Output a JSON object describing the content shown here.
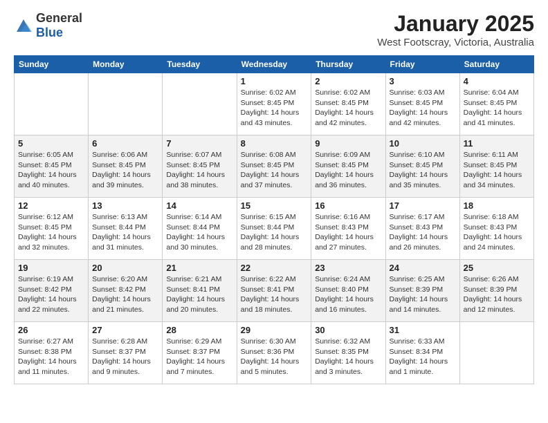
{
  "logo": {
    "general": "General",
    "blue": "Blue"
  },
  "title": "January 2025",
  "subtitle": "West Footscray, Victoria, Australia",
  "headers": [
    "Sunday",
    "Monday",
    "Tuesday",
    "Wednesday",
    "Thursday",
    "Friday",
    "Saturday"
  ],
  "weeks": [
    [
      {
        "day": "",
        "info": ""
      },
      {
        "day": "",
        "info": ""
      },
      {
        "day": "",
        "info": ""
      },
      {
        "day": "1",
        "info": "Sunrise: 6:02 AM\nSunset: 8:45 PM\nDaylight: 14 hours\nand 43 minutes."
      },
      {
        "day": "2",
        "info": "Sunrise: 6:02 AM\nSunset: 8:45 PM\nDaylight: 14 hours\nand 42 minutes."
      },
      {
        "day": "3",
        "info": "Sunrise: 6:03 AM\nSunset: 8:45 PM\nDaylight: 14 hours\nand 42 minutes."
      },
      {
        "day": "4",
        "info": "Sunrise: 6:04 AM\nSunset: 8:45 PM\nDaylight: 14 hours\nand 41 minutes."
      }
    ],
    [
      {
        "day": "5",
        "info": "Sunrise: 6:05 AM\nSunset: 8:45 PM\nDaylight: 14 hours\nand 40 minutes."
      },
      {
        "day": "6",
        "info": "Sunrise: 6:06 AM\nSunset: 8:45 PM\nDaylight: 14 hours\nand 39 minutes."
      },
      {
        "day": "7",
        "info": "Sunrise: 6:07 AM\nSunset: 8:45 PM\nDaylight: 14 hours\nand 38 minutes."
      },
      {
        "day": "8",
        "info": "Sunrise: 6:08 AM\nSunset: 8:45 PM\nDaylight: 14 hours\nand 37 minutes."
      },
      {
        "day": "9",
        "info": "Sunrise: 6:09 AM\nSunset: 8:45 PM\nDaylight: 14 hours\nand 36 minutes."
      },
      {
        "day": "10",
        "info": "Sunrise: 6:10 AM\nSunset: 8:45 PM\nDaylight: 14 hours\nand 35 minutes."
      },
      {
        "day": "11",
        "info": "Sunrise: 6:11 AM\nSunset: 8:45 PM\nDaylight: 14 hours\nand 34 minutes."
      }
    ],
    [
      {
        "day": "12",
        "info": "Sunrise: 6:12 AM\nSunset: 8:45 PM\nDaylight: 14 hours\nand 32 minutes."
      },
      {
        "day": "13",
        "info": "Sunrise: 6:13 AM\nSunset: 8:44 PM\nDaylight: 14 hours\nand 31 minutes."
      },
      {
        "day": "14",
        "info": "Sunrise: 6:14 AM\nSunset: 8:44 PM\nDaylight: 14 hours\nand 30 minutes."
      },
      {
        "day": "15",
        "info": "Sunrise: 6:15 AM\nSunset: 8:44 PM\nDaylight: 14 hours\nand 28 minutes."
      },
      {
        "day": "16",
        "info": "Sunrise: 6:16 AM\nSunset: 8:43 PM\nDaylight: 14 hours\nand 27 minutes."
      },
      {
        "day": "17",
        "info": "Sunrise: 6:17 AM\nSunset: 8:43 PM\nDaylight: 14 hours\nand 26 minutes."
      },
      {
        "day": "18",
        "info": "Sunrise: 6:18 AM\nSunset: 8:43 PM\nDaylight: 14 hours\nand 24 minutes."
      }
    ],
    [
      {
        "day": "19",
        "info": "Sunrise: 6:19 AM\nSunset: 8:42 PM\nDaylight: 14 hours\nand 22 minutes."
      },
      {
        "day": "20",
        "info": "Sunrise: 6:20 AM\nSunset: 8:42 PM\nDaylight: 14 hours\nand 21 minutes."
      },
      {
        "day": "21",
        "info": "Sunrise: 6:21 AM\nSunset: 8:41 PM\nDaylight: 14 hours\nand 20 minutes."
      },
      {
        "day": "22",
        "info": "Sunrise: 6:22 AM\nSunset: 8:41 PM\nDaylight: 14 hours\nand 18 minutes."
      },
      {
        "day": "23",
        "info": "Sunrise: 6:24 AM\nSunset: 8:40 PM\nDaylight: 14 hours\nand 16 minutes."
      },
      {
        "day": "24",
        "info": "Sunrise: 6:25 AM\nSunset: 8:39 PM\nDaylight: 14 hours\nand 14 minutes."
      },
      {
        "day": "25",
        "info": "Sunrise: 6:26 AM\nSunset: 8:39 PM\nDaylight: 14 hours\nand 12 minutes."
      }
    ],
    [
      {
        "day": "26",
        "info": "Sunrise: 6:27 AM\nSunset: 8:38 PM\nDaylight: 14 hours\nand 11 minutes."
      },
      {
        "day": "27",
        "info": "Sunrise: 6:28 AM\nSunset: 8:37 PM\nDaylight: 14 hours\nand 9 minutes."
      },
      {
        "day": "28",
        "info": "Sunrise: 6:29 AM\nSunset: 8:37 PM\nDaylight: 14 hours\nand 7 minutes."
      },
      {
        "day": "29",
        "info": "Sunrise: 6:30 AM\nSunset: 8:36 PM\nDaylight: 14 hours\nand 5 minutes."
      },
      {
        "day": "30",
        "info": "Sunrise: 6:32 AM\nSunset: 8:35 PM\nDaylight: 14 hours\nand 3 minutes."
      },
      {
        "day": "31",
        "info": "Sunrise: 6:33 AM\nSunset: 8:34 PM\nDaylight: 14 hours\nand 1 minute."
      },
      {
        "day": "",
        "info": ""
      }
    ]
  ]
}
